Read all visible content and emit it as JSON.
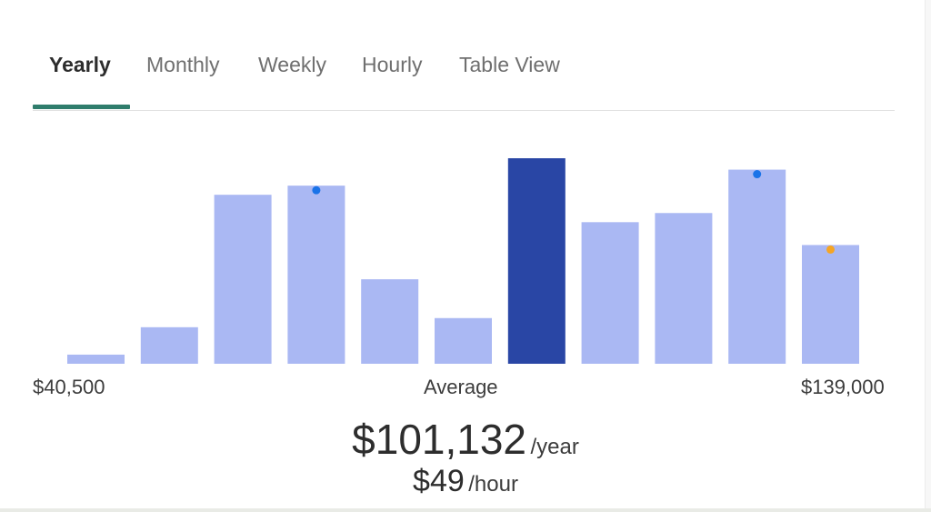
{
  "tabs": [
    {
      "label": "Yearly",
      "active": true
    },
    {
      "label": "Monthly",
      "active": false
    },
    {
      "label": "Weekly",
      "active": false
    },
    {
      "label": "Hourly",
      "active": false
    },
    {
      "label": "Table View",
      "active": false
    }
  ],
  "chart_data": {
    "type": "bar",
    "categories": [
      "",
      "",
      "",
      "",
      "",
      "",
      "",
      "",
      "",
      "",
      ""
    ],
    "values": [
      4,
      16,
      74,
      78,
      37,
      20,
      90,
      62,
      66,
      85,
      52
    ],
    "highlight_index": 6,
    "markers": [
      {
        "index": 3,
        "color": "#1a73e8"
      },
      {
        "index": 9,
        "color": "#1a73e8"
      },
      {
        "index": 10,
        "color": "#f5a524"
      }
    ],
    "ylim": [
      0,
      90
    ],
    "grid": false,
    "colors": {
      "bar": "#aab8f3",
      "highlight": "#2946a5"
    },
    "x_min_label": "$40,500",
    "x_mid_label": "Average",
    "x_max_label": "$139,000"
  },
  "summary": {
    "yearly_value": "$101,132",
    "yearly_unit": "/year",
    "hourly_value": "$49",
    "hourly_unit": "/hour"
  },
  "colors": {
    "tab_accent": "#2f7d6c"
  }
}
